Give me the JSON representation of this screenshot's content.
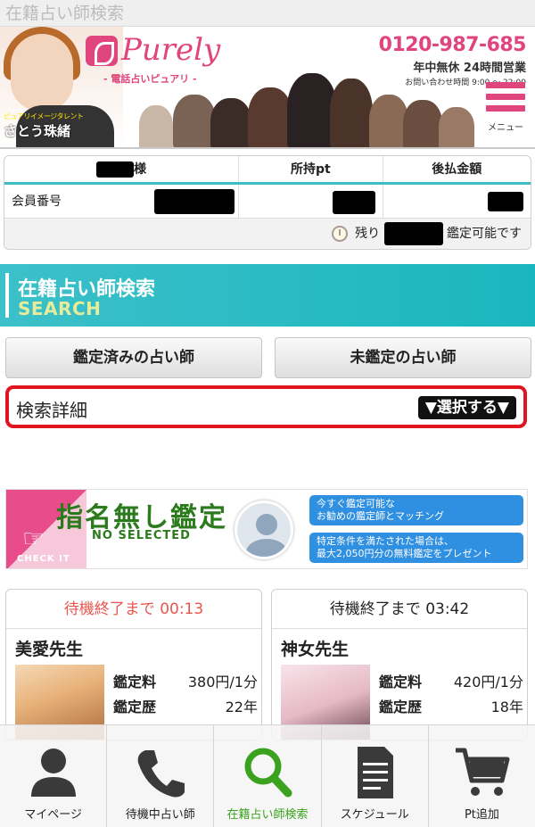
{
  "page": {
    "title": "在籍占い師検索"
  },
  "header": {
    "logo": {
      "word": "Purely",
      "tagline": "- 電話占いピュアリ -"
    },
    "talent": {
      "subtitle": "ピュアリイメージタレント",
      "name": "さとう珠緒"
    },
    "phone": {
      "number": "0120-987-685",
      "hours": "年中無休 24時間営業",
      "contact": "お問い合わせ時間 9:00 ～ 22:00"
    },
    "menu_label": "メニュー"
  },
  "member": {
    "name_suffix": "様",
    "points_header": "所持pt",
    "deferred_header": "後払金額",
    "member_no_label": "会員番号",
    "remaining_prefix": "残り",
    "remaining_suffix": "鑑定可能です"
  },
  "search": {
    "title_ja": "在籍占い師検索",
    "title_en": "SEARCH",
    "btn_done": "鑑定済みの占い師",
    "btn_not_done": "未鑑定の占い師",
    "detail_label": "検索詳細",
    "detail_select": "▼選択する▼"
  },
  "no_selected": {
    "title": "指名無し鑑定",
    "subtitle": "NO SELECTED",
    "check_it": "CHECK IT",
    "pill1_line1": "今すぐ鑑定可能な",
    "pill1_line2": "お勧めの鑑定師とマッチング",
    "pill2_line1": "特定条件を満たされた場合は、",
    "pill2_line2": "最大2,050円分の無料鑑定をプレゼント"
  },
  "cards": [
    {
      "wait": "待機終了まで 00:13",
      "wait_color": "#e8554e",
      "name": "美愛先生",
      "fee_label": "鑑定料",
      "fee": "380円/1分",
      "exp_label": "鑑定歴",
      "exp": "22年"
    },
    {
      "wait": "待機終了まで 03:42",
      "wait_color": "#222222",
      "name": "神女先生",
      "fee_label": "鑑定料",
      "fee": "420円/1分",
      "exp_label": "鑑定歴",
      "exp": "18年"
    }
  ],
  "tabbar": [
    {
      "label": "マイページ",
      "icon": "person-icon"
    },
    {
      "label": "待機中占い師",
      "icon": "phone-icon"
    },
    {
      "label": "在籍占い師検索",
      "icon": "search-icon",
      "active": true
    },
    {
      "label": "スケジュール",
      "icon": "document-icon"
    },
    {
      "label": "Pt追加",
      "icon": "cart-icon"
    }
  ],
  "colors": {
    "brand_pink": "#e0457d",
    "teal": "#3cc0c9",
    "highlight_red": "#e1151f",
    "active_green": "#3aa21e"
  }
}
